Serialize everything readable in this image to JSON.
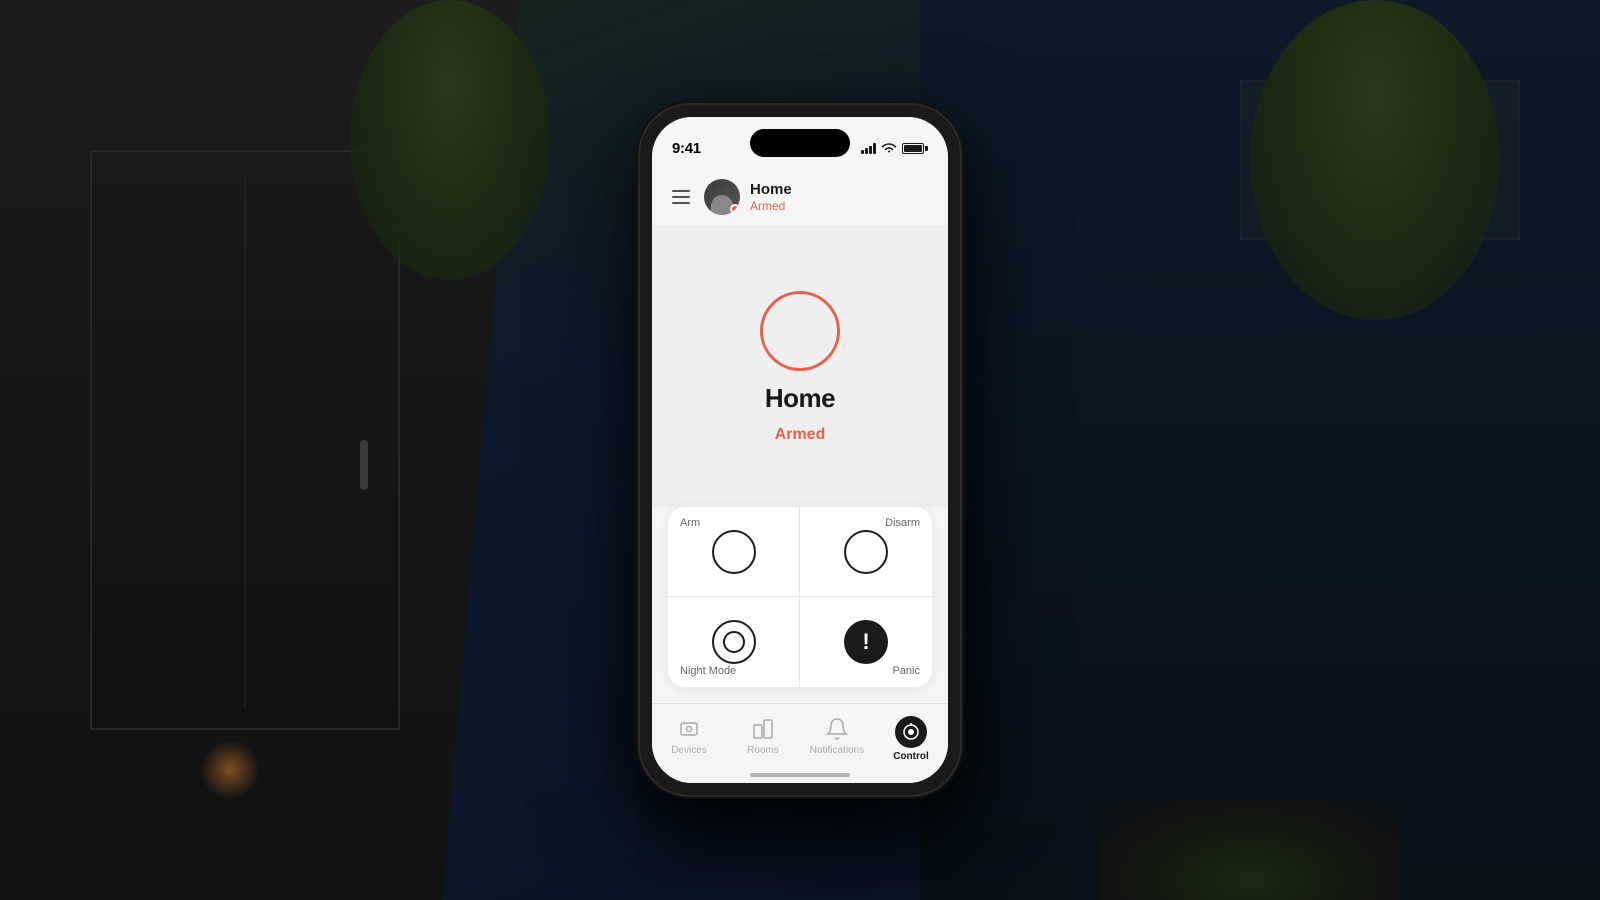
{
  "background": {
    "color": "#0a1628"
  },
  "status_bar": {
    "time": "9:41",
    "signal_label": "signal",
    "wifi_label": "wifi",
    "battery_label": "battery"
  },
  "header": {
    "menu_label": "menu",
    "avatar_label": "avatar",
    "title": "Home",
    "status": "Armed"
  },
  "main": {
    "circle_label": "armed-circle",
    "title": "Home",
    "status": "Armed"
  },
  "controls": {
    "arm_label": "Arm",
    "disarm_label": "Disarm",
    "night_mode_label": "Night Mode",
    "panic_label": "Panic"
  },
  "tab_bar": {
    "devices_label": "Devices",
    "rooms_label": "Rooms",
    "notifications_label": "Notifications",
    "control_label": "Control"
  },
  "colors": {
    "accent": "#e8624a",
    "primary": "#1a1a1a",
    "background": "#f5f5f5",
    "card": "#ffffff",
    "muted": "#888888"
  }
}
